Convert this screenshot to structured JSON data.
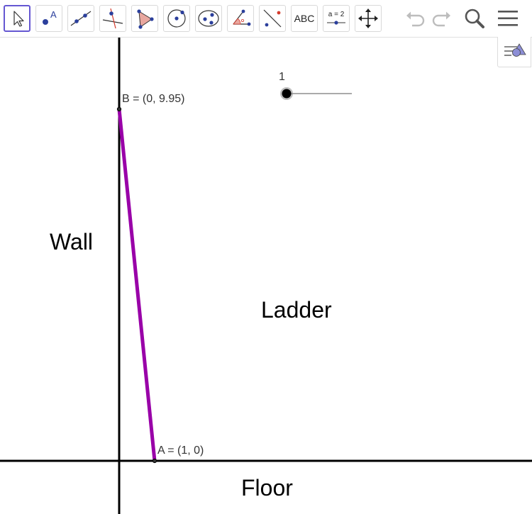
{
  "toolbar": {
    "tools": [
      {
        "name": "move-tool-icon",
        "selected": true
      },
      {
        "name": "point-tool-icon"
      },
      {
        "name": "line-tool-icon"
      },
      {
        "name": "perpendicular-line-tool-icon"
      },
      {
        "name": "polygon-tool-icon"
      },
      {
        "name": "circle-tool-icon"
      },
      {
        "name": "ellipse-tool-icon"
      },
      {
        "name": "angle-tool-icon"
      },
      {
        "name": "reflect-tool-icon"
      },
      {
        "name": "text-tool-icon",
        "label": "ABC"
      },
      {
        "name": "slider-tool-icon",
        "label": "a = 2"
      },
      {
        "name": "move-graphics-view-tool-icon"
      }
    ],
    "right_icons": [
      "undo-icon",
      "redo-icon",
      "search-icon",
      "menu-icon"
    ]
  },
  "style_bar_toggle": {
    "icon": "style-bar-toggle-icon"
  },
  "graphics": {
    "wall_label": "Wall",
    "ladder_label": "Ladder",
    "floor_label": "Floor",
    "point_b_label": "B = (0, 9.95)",
    "point_a_label": "A = (1, 0)",
    "slider_value": "1",
    "slider_fraction": 0.0,
    "ladder_color": "#9900a8",
    "axis_color": "#000000"
  },
  "colors": {
    "selected_tool_border": "#6557d2",
    "tool_icon_blue": "#2b3f9c",
    "polygon_fill": "#e9a79f",
    "angle_red": "#d43c2e",
    "style_icon_blue": "#8c8ed6"
  }
}
